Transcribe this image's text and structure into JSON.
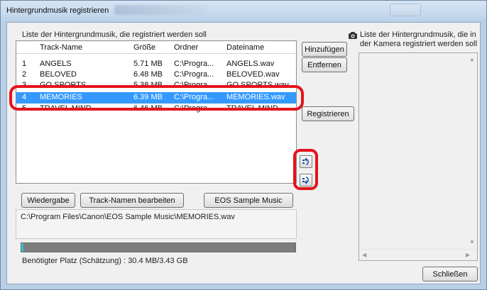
{
  "window": {
    "title": "Hintergrundmusik registrieren"
  },
  "left": {
    "caption": "Liste der Hintergrundmusik, die registriert werden soll",
    "columns": [
      "Track-Name",
      "Größe",
      "Ordner",
      "Dateiname"
    ],
    "rows": [
      {
        "num": "1",
        "name": "ANGELS",
        "size": "5.71 MB",
        "folder": "C:\\Progra...",
        "file": "ANGELS.wav"
      },
      {
        "num": "2",
        "name": "BELOVED",
        "size": "6.48 MB",
        "folder": "C:\\Progra...",
        "file": "BELOVED.wav"
      },
      {
        "num": "3",
        "name": "GO SPORTS",
        "size": "5.38 MB",
        "folder": "C:\\Progra...",
        "file": "GO SPORTS.wav"
      },
      {
        "num": "4",
        "name": "MEMORIES",
        "size": "6.39 MB",
        "folder": "C:\\Progra...",
        "file": "MEMORIES.wav",
        "selected": true
      },
      {
        "num": "5",
        "name": "TRAVEL MIND",
        "size": "6.46 MB",
        "folder": "C:\\Progra...",
        "file": "TRAVEL MIND...."
      }
    ],
    "buttons": {
      "play": "Wiedergabe",
      "rename": "Track-Namen bearbeiten",
      "sample": "EOS Sample Music"
    },
    "path": "C:\\Program Files\\Canon\\EOS Sample Music\\MEMORIES.wav",
    "space_label": "Benötigter Platz (Schätzung) : 30.4 MB/3.43 GB",
    "space_fraction": 0.009
  },
  "middle": {
    "add": "Hinzufügen",
    "remove": "Entfernen",
    "register": "Registrieren"
  },
  "right": {
    "caption_line1": "Liste der Hintergrundmusik, die in",
    "caption_line2": "der Kamera registriert werden soll"
  },
  "close_button": "Schließen",
  "icons": {
    "camera": "camera-icon",
    "move_up": "move-up-icon",
    "move_down": "move-down-icon"
  },
  "colors": {
    "selection": "#3399ff",
    "highlight": "#e4141b",
    "progress": "#2ec4d6"
  }
}
